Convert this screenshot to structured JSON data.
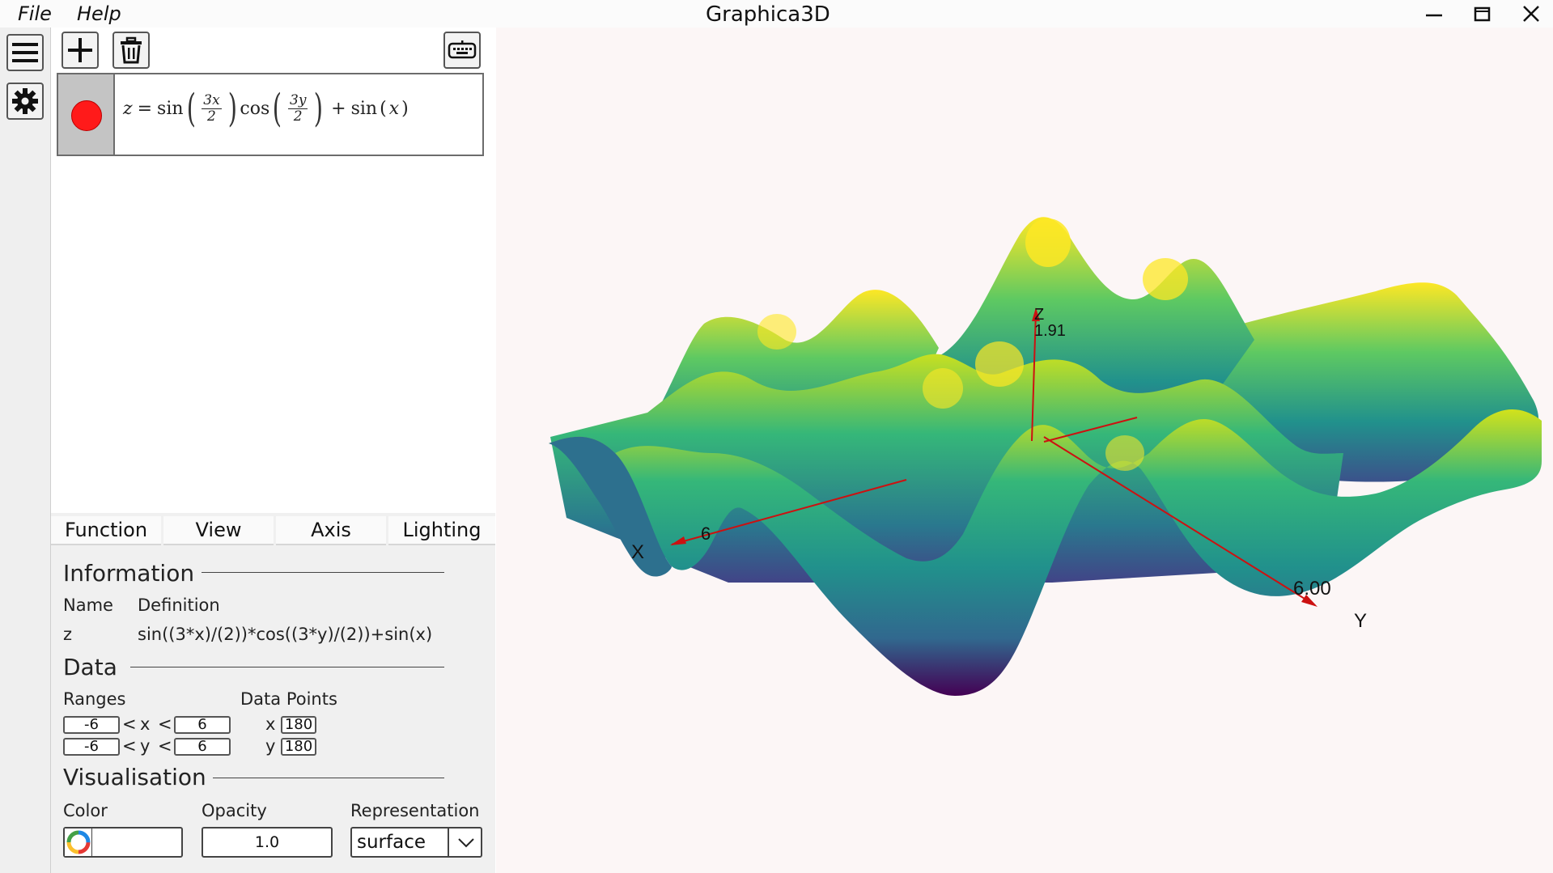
{
  "app": {
    "title": "Graphica3D",
    "menu": [
      "File",
      "Help"
    ]
  },
  "toolbar": {
    "add_icon": "plus-icon",
    "delete_icon": "trash-icon",
    "keyboard_icon": "keyboard-icon",
    "menu_icon": "hamburger-icon",
    "settings_icon": "gear-icon"
  },
  "function_entry": {
    "color": "#ff1a1a",
    "formula": {
      "lhs": "z",
      "eq": "=",
      "sin": "sin",
      "cos": "cos",
      "frac1_num": "3x",
      "frac1_den": "2",
      "frac2_num": "3y",
      "frac2_den": "2",
      "plus": "+",
      "tail_fn": "sin",
      "tail_arg": "x"
    }
  },
  "tabs": [
    "Function",
    "View",
    "Axis",
    "Lighting"
  ],
  "information": {
    "heading": "Information",
    "name_header": "Name",
    "definition_header": "Definition",
    "name": "z",
    "definition": "sin((3*x)/(2))*cos((3*y)/(2))+sin(x)"
  },
  "data_section": {
    "heading": "Data",
    "ranges_label": "Ranges",
    "data_points_label": "Data Points",
    "x_min": "-6",
    "x_max": "6",
    "y_min": "-6",
    "y_max": "6",
    "x_var": "x",
    "y_var": "y",
    "lt": "<",
    "x_points": "180",
    "y_points": "180"
  },
  "visualisation": {
    "heading": "Visualisation",
    "color_label": "Color",
    "opacity_label": "Opacity",
    "representation_label": "Representation",
    "opacity": "1.0",
    "representation": "surface"
  },
  "plot": {
    "axis_labels": {
      "x": "X",
      "y": "Y",
      "z": "Z"
    },
    "axis_values": {
      "x_end": "6",
      "y_end": "6.00",
      "z_end": "1.91"
    },
    "colors": {
      "background": "#fcf6f6",
      "axis": "#cc1111",
      "low": "#440154",
      "mid": "#21918c",
      "high": "#fde725"
    }
  }
}
